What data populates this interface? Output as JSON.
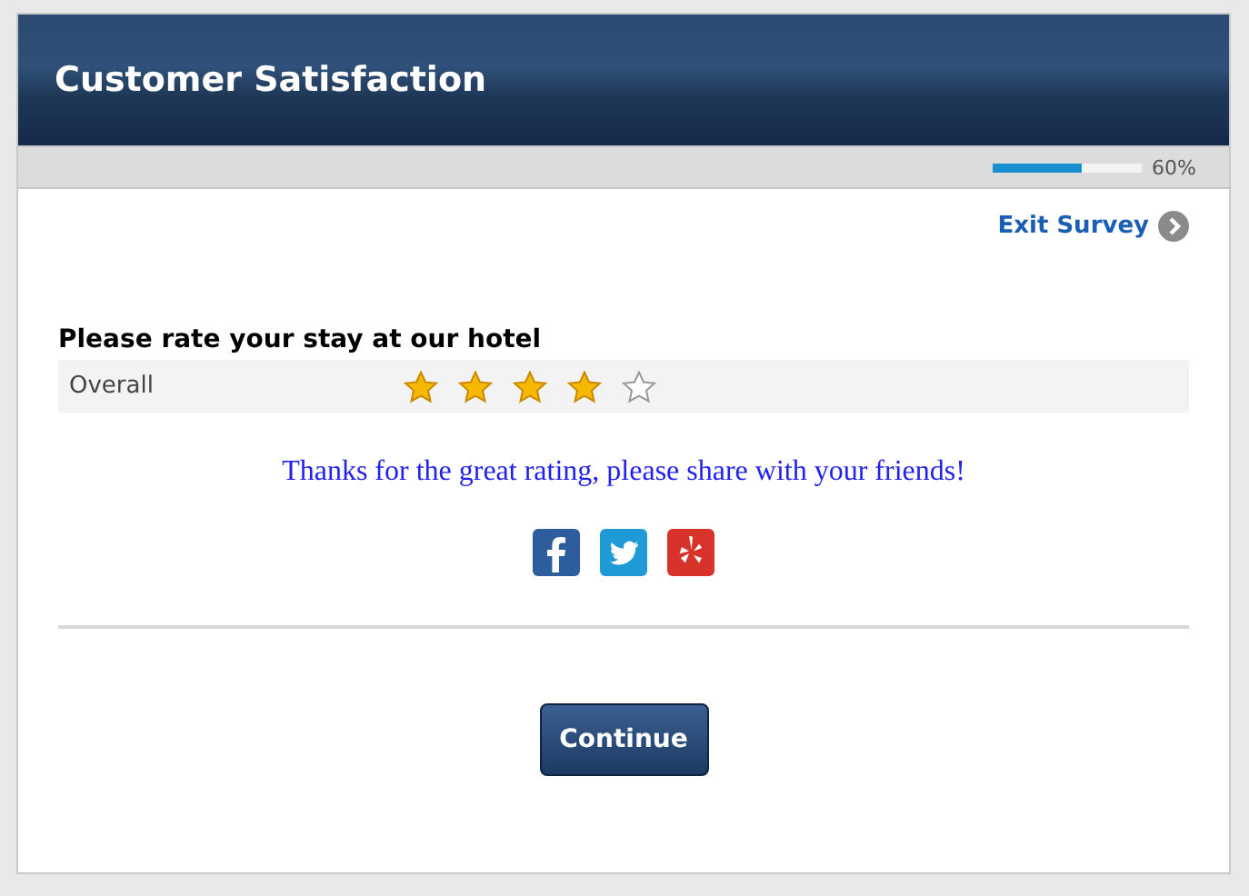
{
  "header": {
    "title": "Customer Satisfaction"
  },
  "progress": {
    "level": 0.6,
    "reading": "60%"
  },
  "exit_link": {
    "label": "Exit Survey"
  },
  "question": {
    "title": "Please rate your stay at our hotel",
    "rows": [
      {
        "label": "Overall",
        "stars": 4
      }
    ]
  },
  "message": "Thanks for the great rating, please share with your friends!",
  "share_buttons": [
    {
      "kind": "facebook"
    },
    {
      "kind": "twitter"
    },
    {
      "kind": "yelp"
    }
  ],
  "continue_button": {
    "label": "Continue"
  }
}
